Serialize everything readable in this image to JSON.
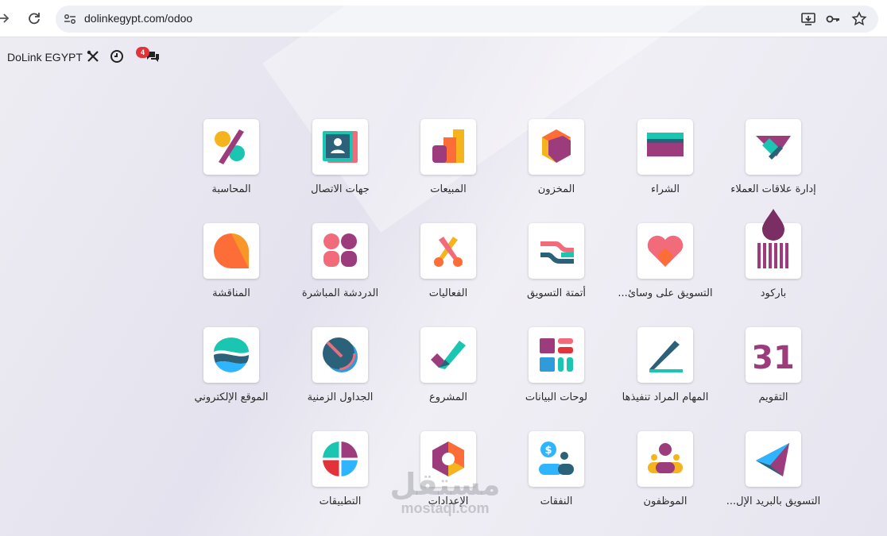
{
  "browser": {
    "url": "dolinkegypt.com/odoo"
  },
  "navbar": {
    "brand": "DoLink EGYPT",
    "chat_badge": "4"
  },
  "apps": [
    {
      "label": "إدارة علاقات العملاء",
      "icon": "crm-icon"
    },
    {
      "label": "الشراء",
      "icon": "purchase-icon"
    },
    {
      "label": "المخزون",
      "icon": "inventory-icon"
    },
    {
      "label": "المبيعات",
      "icon": "sales-icon"
    },
    {
      "label": "جهات الاتصال",
      "icon": "contacts-icon"
    },
    {
      "label": "المحاسبة",
      "icon": "accounting-icon"
    },
    {
      "label": "باركود",
      "icon": "barcode-icon"
    },
    {
      "label": "التسويق على وسائ...",
      "icon": "social-marketing-icon"
    },
    {
      "label": "أتمتة التسويق",
      "icon": "marketing-automation-icon"
    },
    {
      "label": "الفعاليات",
      "icon": "events-icon"
    },
    {
      "label": "الدردشة المباشرة",
      "icon": "live-chat-icon"
    },
    {
      "label": "المناقشة",
      "icon": "discuss-icon"
    },
    {
      "label": "التقويم",
      "icon": "calendar-icon"
    },
    {
      "label": "المهام المراد تنفيذها",
      "icon": "todo-icon"
    },
    {
      "label": "لوحات البيانات",
      "icon": "dashboards-icon"
    },
    {
      "label": "المشروع",
      "icon": "project-icon"
    },
    {
      "label": "الجداول الزمنية",
      "icon": "timesheets-icon"
    },
    {
      "label": "الموقع الإلكتروني",
      "icon": "website-icon"
    },
    {
      "label": "التسويق بالبريد الإل...",
      "icon": "email-marketing-icon"
    },
    {
      "label": "الموظفون",
      "icon": "employees-icon"
    },
    {
      "label": "النفقات",
      "icon": "expenses-icon"
    },
    {
      "label": "الإعدادات",
      "icon": "settings-icon"
    },
    {
      "label": "التطبيقات",
      "icon": "apps-icon"
    }
  ],
  "calendar_day": "31",
  "watermark": {
    "arabic": "مستقل",
    "latin": "mostaql.com"
  }
}
